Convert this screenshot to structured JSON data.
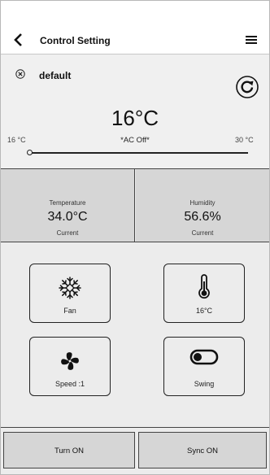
{
  "header": {
    "title": "Control Setting",
    "back_icon": "chevron-left-icon",
    "menu_icon": "hamburger-menu-icon"
  },
  "control": {
    "profile_name": "default",
    "set_temperature": "16°C",
    "ac_status": "*AC Off*",
    "slider": {
      "min_label": "16 °C",
      "max_label": "30 °C",
      "value": 16,
      "min": 16,
      "max": 30
    }
  },
  "sensors": {
    "temperature": {
      "label": "Temperature",
      "value": "34.0°C",
      "sub": "Current"
    },
    "humidity": {
      "label": "Humidity",
      "value": "56.6%",
      "sub": "Current"
    }
  },
  "tiles": {
    "fan": {
      "label": "Fan",
      "icon": "snowflake-icon"
    },
    "temp": {
      "label": "16°C",
      "icon": "thermometer-icon"
    },
    "speed": {
      "label": "Speed :1",
      "icon": "fan-icon"
    },
    "swing": {
      "label": "Swing",
      "icon": "toggle-icon"
    }
  },
  "footer": {
    "turn_on": "Turn ON",
    "sync_on": "Sync ON"
  },
  "colors": {
    "panel": "#f0f0f0",
    "sensor_bg": "#d6d6d6",
    "background": "#ececec",
    "text": "#111111"
  }
}
